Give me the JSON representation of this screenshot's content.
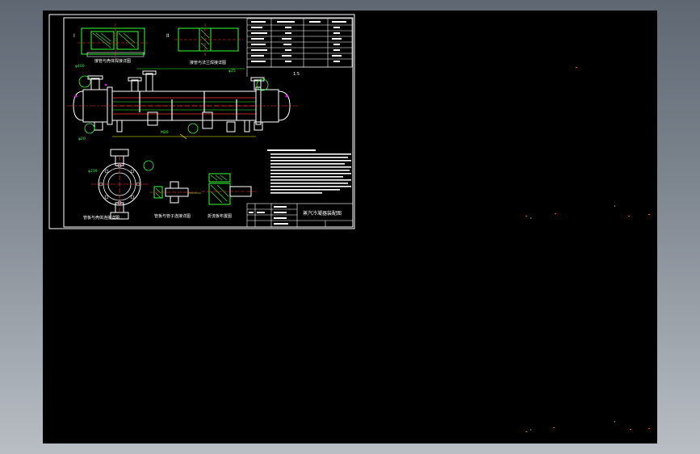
{
  "drawing": {
    "detail_marks": [
      "I",
      "II"
    ],
    "title_block_name": "蒸汽冷凝器装配图",
    "scale_note": "1:5",
    "dimension_labels": [
      "φ400",
      "φ20",
      "φ25",
      "φ219",
      "M20"
    ],
    "view_labels": [
      "接管与壳体焊接详图",
      "接管与法兰焊接详图",
      "管板与壳体连接详图",
      "管板与管子连接详图",
      "折流板布置图"
    ]
  },
  "colors": {
    "background": "#000000",
    "frame": "#ffffff",
    "component": "#00ff00",
    "centerline": "#ff3333",
    "dimension": "#ffff00",
    "accent": "#ff00ff"
  }
}
